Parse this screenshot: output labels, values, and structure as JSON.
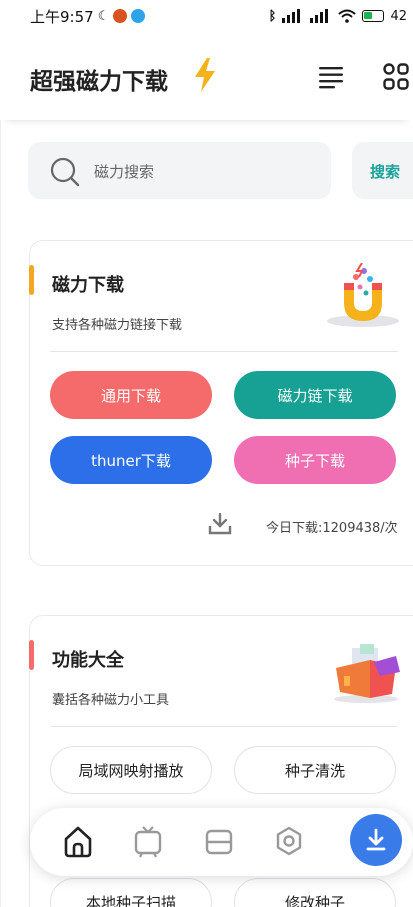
{
  "status_bar": {
    "time": "上午9:57",
    "battery": "42"
  },
  "header": {
    "title": "超强磁力下载"
  },
  "search": {
    "placeholder": "磁力搜索",
    "button_label": "搜索"
  },
  "card_download": {
    "title": "磁力下载",
    "subtitle": "支持各种磁力链接下载",
    "accent_color": "#f5a623",
    "buttons": [
      {
        "label": "通用下载",
        "color": "#f56b6b"
      },
      {
        "label": "磁力链下载",
        "color": "#17a195"
      },
      {
        "label": "thuner下载",
        "color": "#2c6fe8"
      },
      {
        "label": "种子下载",
        "color": "#f06fb3"
      }
    ],
    "today_downloads": "今日下载:1209438/次"
  },
  "card_tools": {
    "title": "功能大全",
    "subtitle": "囊括各种磁力小工具",
    "accent_color": "#f56b6b",
    "buttons": [
      {
        "label": "局域网映射播放"
      },
      {
        "label": "种子清洗"
      },
      {
        "label": "本地种子扫描"
      },
      {
        "label": "修改种子"
      }
    ]
  },
  "bottom_nav": {
    "items": [
      "home-icon",
      "tv-icon",
      "card-icon",
      "settings-icon"
    ],
    "active_color": "#222222",
    "fab_color": "#3a7bea"
  }
}
